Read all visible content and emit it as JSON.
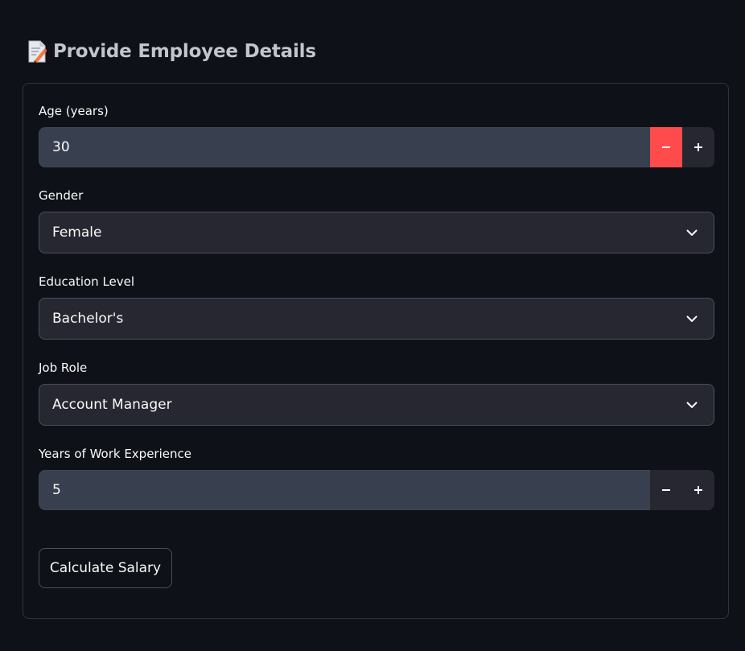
{
  "header": {
    "title": "Provide Employee Details",
    "icon": "memo-icon"
  },
  "form": {
    "age": {
      "label": "Age (years)",
      "value": "30",
      "decrement_symbol": "minus-icon",
      "increment_symbol": "plus-icon"
    },
    "gender": {
      "label": "Gender",
      "selected": "Female"
    },
    "education": {
      "label": "Education Level",
      "selected": "Bachelor's"
    },
    "job_role": {
      "label": "Job Role",
      "selected": "Account Manager"
    },
    "experience": {
      "label": "Years of Work Experience",
      "value": "5"
    },
    "submit_label": "Calculate Salary"
  },
  "colors": {
    "background": "#0e1117",
    "accent": "#ff4b4b",
    "input_bg": "#262730",
    "number_bg": "#383f4f"
  }
}
